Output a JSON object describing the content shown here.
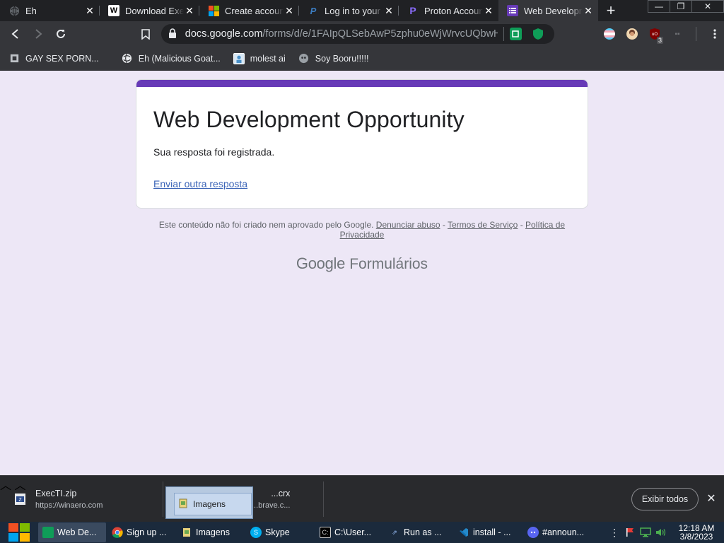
{
  "browser": {
    "tabs": [
      {
        "title": "Eh",
        "icon": "globe-icon"
      },
      {
        "title": "Download Exec",
        "icon": "winaero-icon"
      },
      {
        "title": "Create account",
        "icon": "microsoft-icon"
      },
      {
        "title": "Log in to your P",
        "icon": "paypal-icon"
      },
      {
        "title": "Proton Account",
        "icon": "proton-icon"
      },
      {
        "title": "Web Developm",
        "icon": "google-forms-icon",
        "active": true
      }
    ],
    "new_tab_label": "+",
    "url_host": "docs.google.com",
    "url_path": "/forms/d/e/1FAIpQLSebAwP5zphu0eWjWrvcUQbwH...",
    "bookmarks": [
      {
        "label": "GAY SEX PORN...",
        "icon": "bookmark-site-icon"
      },
      {
        "label": "Eh (Malicious Goat...",
        "icon": "globe-icon"
      },
      {
        "label": "molest ai",
        "icon": "bookmark-site-icon"
      },
      {
        "label": "Soy Booru!!!!!",
        "icon": "bookmark-site-icon"
      }
    ],
    "ublock_count": "3"
  },
  "form": {
    "title": "Web Development Opportunity",
    "response_message": "Sua resposta foi registrada.",
    "submit_another": "Enviar outra resposta",
    "accent_color": "#673ab7",
    "disclaimer_text": "Este conteúdo não foi criado nem aprovado pelo Google.",
    "report_abuse": "Denunciar abuso",
    "terms": "Termos de Serviço",
    "privacy": "Política de Privacidade",
    "footer_brand_google": "Google",
    "footer_brand_product": "Formulários"
  },
  "downloads": {
    "items": [
      {
        "name": "ExecTI.zip",
        "source": "https://winaero.com"
      },
      {
        "name": "...crx",
        "source": "...brave.c..."
      }
    ],
    "show_all": "Exibir todos"
  },
  "tooltip": {
    "label": "Imagens"
  },
  "taskbar": {
    "items": [
      {
        "label": "Web De...",
        "active": true
      },
      {
        "label": "Sign up ..."
      },
      {
        "label": "Imagens"
      },
      {
        "label": "Skype"
      },
      {
        "label": "C:\\User..."
      },
      {
        "label": "Run as ..."
      },
      {
        "label": "install - ..."
      },
      {
        "label": "#announ..."
      }
    ],
    "time": "12:18 AM",
    "date": "3/8/2023"
  }
}
